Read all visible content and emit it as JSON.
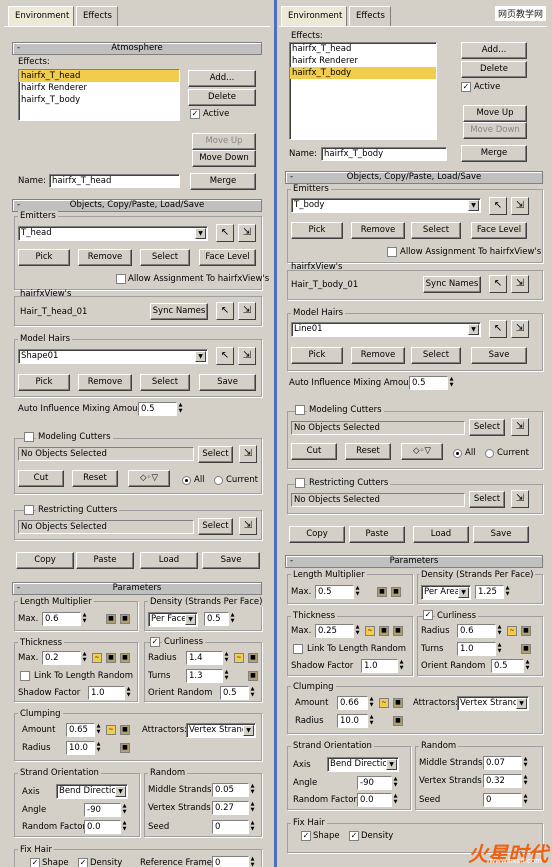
{
  "tabs": {
    "environment": "Environment",
    "effects": "Effects"
  },
  "atmosphere": {
    "title": "Atmosphere",
    "effects_label": "Effects:",
    "add": "Add...",
    "delete": "Delete",
    "active": "Active",
    "move_up": "Move Up",
    "move_down": "Move Down",
    "name_label": "Name:",
    "merge": "Merge"
  },
  "left": {
    "effects_list": [
      "hairfx_T_head",
      "hairfx Renderer",
      "hairfx_T_body"
    ],
    "name_value": "hairfx_T_head",
    "emitter_value": "T_head",
    "model_hair_value": "Shape01",
    "auto_influence": "0.5",
    "hairfxview_name": "Hair_T_head_01",
    "length_max": "0.6",
    "density_mode": "Per Face",
    "density_value": "0.5",
    "thickness_max": "0.2",
    "shadow_factor": "1.0",
    "radius": "1.4",
    "turns": "1.3",
    "orient_random": "0.5",
    "clump_amount": "0.65",
    "clump_radius": "10.0",
    "attractors": "Vertex Strands",
    "axis": "Bend Direction",
    "angle": "-90",
    "random_factor": "0.0",
    "middle_strands": "0.05",
    "vertex_strands": "0.27",
    "seed": "0",
    "ref_frame": "0"
  },
  "right": {
    "effects_list": [
      "hairfx_T_head",
      "hairfx Renderer",
      "hairfx_T_body"
    ],
    "name_value": "hairfx_T_body",
    "emitter_value": "T_body",
    "model_hair_value": "Line01",
    "auto_influence": "0.5",
    "hairfxview_name": "Hair_T_body_01",
    "length_max": "0.5",
    "density_mode": "Per Area",
    "density_value": "1.25",
    "thickness_max": "0.25",
    "shadow_factor": "1.0",
    "radius": "0.6",
    "turns": "1.0",
    "orient_random": "0.5",
    "clump_amount": "0.66",
    "clump_radius": "10.0",
    "attractors": "Vertex Strands",
    "axis": "Bend Direction",
    "angle": "-90",
    "random_factor": "0.0",
    "middle_strands": "0.07",
    "vertex_strands": "0.32",
    "seed": "0"
  },
  "ocpl": {
    "title": "Objects, Copy/Paste, Load/Save",
    "emitters": "Emitters",
    "pick": "Pick",
    "remove": "Remove",
    "select": "Select",
    "face_level": "Face Level",
    "allow": "Allow Assignment To hairfxView's",
    "hairfxview": "hairfxView's",
    "sync_names": "Sync Names",
    "model_hairs": "Model Hairs",
    "save": "Save",
    "auto_influence_label": "Auto Influence Mixing Amount",
    "modeling_cutters": "Modeling Cutters",
    "no_objects": "No Objects Selected",
    "cut": "Cut",
    "reset": "Reset",
    "all": "All",
    "current": "Current",
    "restricting_cutters": "Restricting Cutters",
    "copy": "Copy",
    "paste": "Paste",
    "load": "Load"
  },
  "params": {
    "title": "Parameters",
    "length_multiplier": "Length Multiplier",
    "max": "Max.",
    "density": "Density (Strands Per Face)",
    "thickness": "Thickness",
    "curliness": "Curliness",
    "radius": "Radius",
    "turns": "Turns",
    "link_length": "Link To Length Random",
    "shadow_factor": "Shadow Factor",
    "orient_random": "Orient Random",
    "clumping": "Clumping",
    "amount": "Amount",
    "attractors": "Attractors:",
    "strand_orientation": "Strand Orientation",
    "axis": "Axis",
    "angle": "Angle",
    "random_factor": "Random Factor",
    "random": "Random",
    "middle_strands": "Middle Strands",
    "vertex_strands": "Vertex Strands",
    "seed": "Seed",
    "fix_hair": "Fix Hair",
    "shape": "Shape",
    "density_chk": "Density",
    "reference_frame": "Reference Frame"
  },
  "watermark": {
    "site": "网页教学网",
    "url": "www.hxsd.com"
  },
  "colors": {
    "selection": "#f2cc4c",
    "panel": "#d4d0c8",
    "divider": "#4a70c0"
  }
}
